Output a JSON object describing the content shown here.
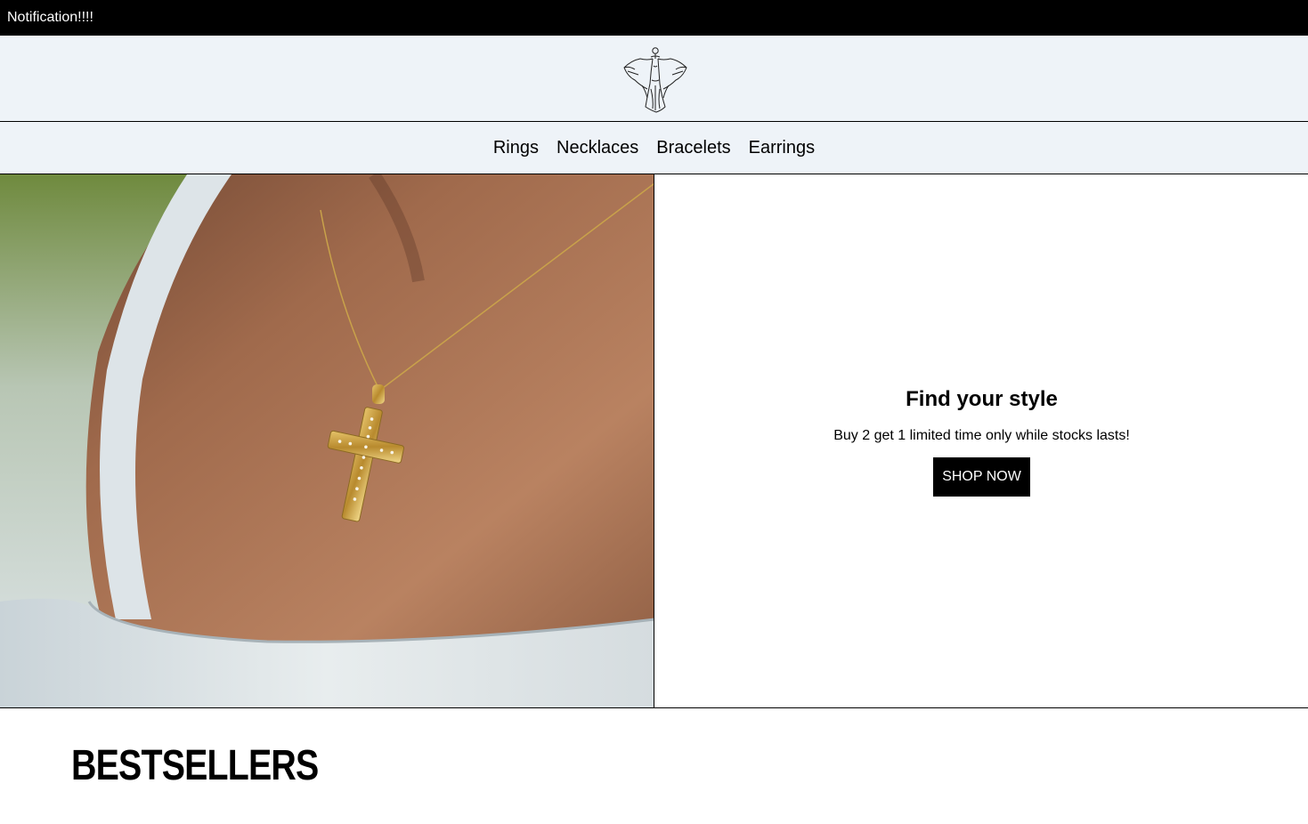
{
  "notification": {
    "text": "Notification!!!!"
  },
  "logo": {
    "icon": "dancer-figure-logo"
  },
  "nav": {
    "items": [
      {
        "label": "Rings"
      },
      {
        "label": "Necklaces"
      },
      {
        "label": "Bracelets"
      },
      {
        "label": "Earrings"
      }
    ]
  },
  "hero": {
    "image": "necklace-cross-pendant-photo",
    "title": "Find your style",
    "subtitle": "Buy 2 get 1 limited time only while stocks lasts!",
    "cta_label": "SHOP NOW"
  },
  "section": {
    "heading": "BESTSELLERS"
  },
  "colors": {
    "notification_bg": "#000000",
    "header_bg": "#eef3f8",
    "button_bg": "#000000",
    "button_text": "#ffffff"
  }
}
